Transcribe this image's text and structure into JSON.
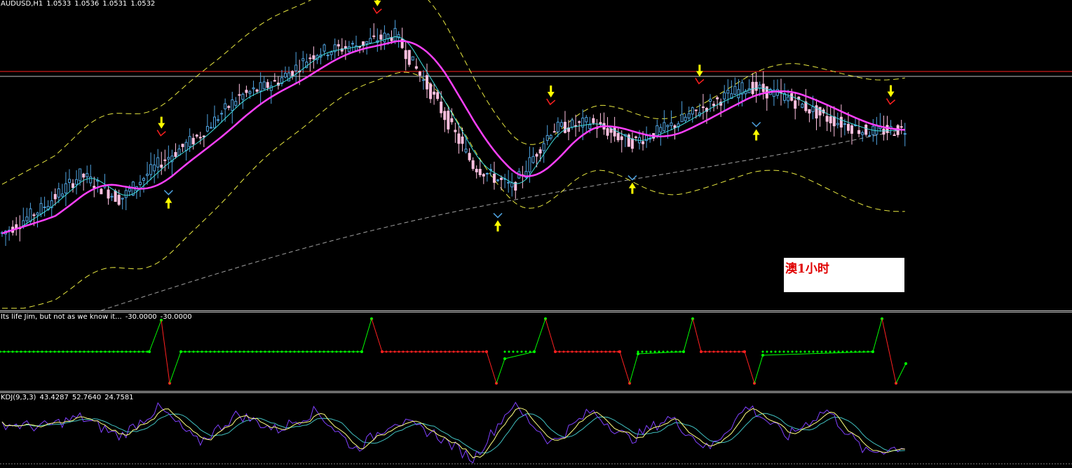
{
  "chart_header": {
    "symbol_timeframe": "AUDUSD,H1",
    "open": "1.0533",
    "high": "1.0536",
    "low": "1.0531",
    "close": "1.0532"
  },
  "annotation_box": {
    "text": "澳1小时"
  },
  "indicator1": {
    "name": "Its life Jim, but not as we know it...",
    "value1": "-30.0000",
    "value2": "-30.0000"
  },
  "indicator2": {
    "name": "KDJ(9,3,3)",
    "k": "43.4287",
    "d": "52.7640",
    "j": "24.7581"
  },
  "colors": {
    "background": "#000000",
    "candle_up": "#4fa3e0",
    "candle_down": "#ffc0e0",
    "ma_fast": "#40e0e0",
    "ma_slow": "#ff40ff",
    "envelope": "#e8e840",
    "ma_long": "#a0a0a0",
    "hline_red": "#ff2020",
    "hline_white": "#c0c0c0",
    "arrow_up": "#ffff00",
    "arrow_down": "#ffff00",
    "signal_green": "#00ff00",
    "signal_red": "#ff2020",
    "kdj_k": "#8040ff",
    "kdj_d": "#ffff80",
    "kdj_j": "#40c0c0"
  },
  "chart_data": {
    "type": "candlestick",
    "title": "",
    "signals_down_at": [
      45,
      106,
      155,
      197,
      251
    ],
    "signals_up_at": [
      47,
      140,
      178,
      213
    ],
    "price_path": [
      1.044,
      1.0462,
      1.0492,
      1.047,
      1.0502,
      1.0526,
      1.056,
      1.0574,
      1.06,
      1.0606,
      1.0616,
      1.056,
      1.05,
      1.048,
      1.0532,
      1.0538,
      1.052,
      1.0534,
      1.0554,
      1.057,
      1.056,
      1.0542,
      1.053,
      1.0532
    ],
    "kdj_k_path": [
      60,
      55,
      70,
      40,
      85,
      30,
      75,
      50,
      80,
      20,
      65,
      45,
      5,
      90,
      30,
      80,
      35,
      70,
      20,
      88,
      40,
      82,
      15,
      25
    ],
    "signal_state": [
      "green",
      "green",
      "green",
      "red",
      "green",
      "green",
      "green",
      "red",
      "green",
      "red",
      "green",
      "red",
      "green",
      "red",
      "green",
      "green",
      "green",
      "red"
    ]
  }
}
